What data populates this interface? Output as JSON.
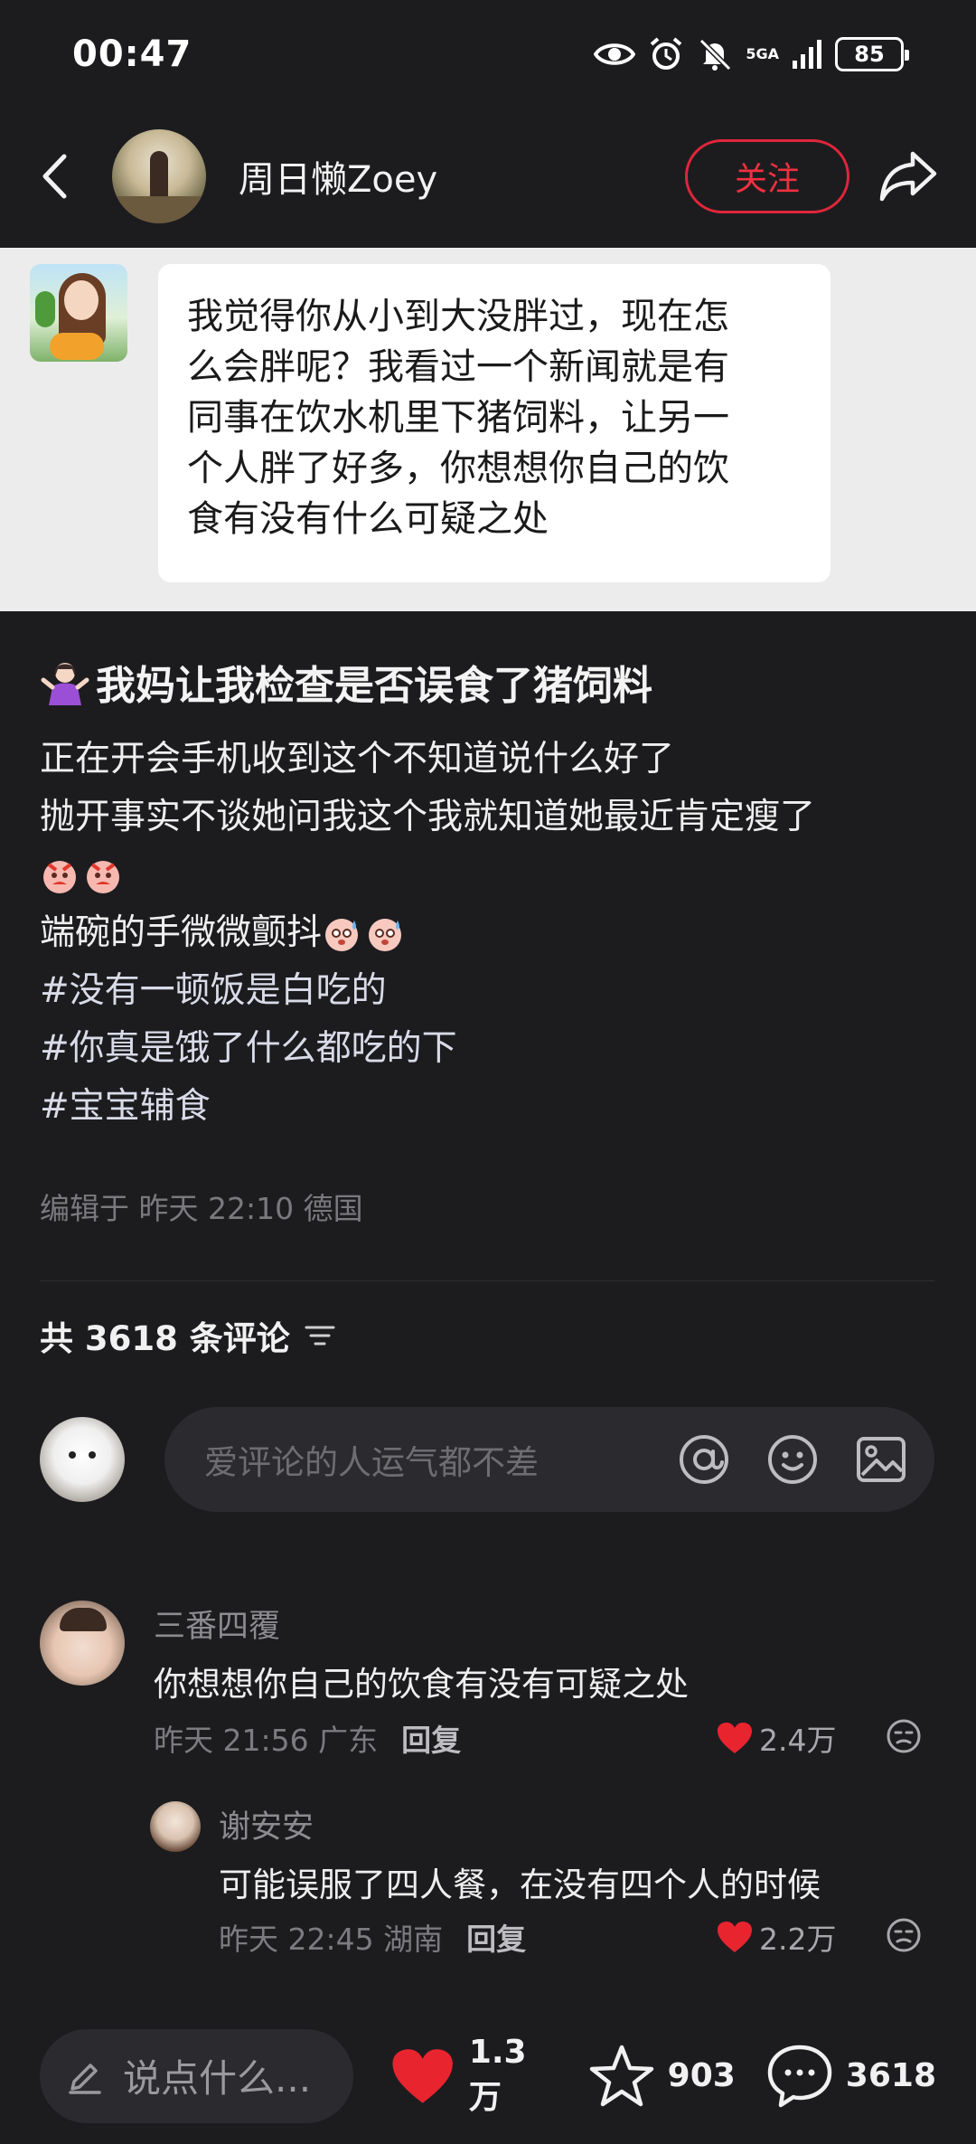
{
  "status_bar": {
    "time": "00:47",
    "network": "5GA",
    "battery": "85"
  },
  "author": {
    "name": "周日懒Zoey",
    "follow_label": "关注"
  },
  "screenshot_chat": {
    "message_lines": [
      "我觉得你从小到大没胖过，现在怎",
      "么会胖呢？我看过一个新闻就是有",
      "同事在饮水机里下猪饲料，让另一",
      "个人胖了好多，你想想你自己的饮",
      "食有没有什么可疑之处"
    ]
  },
  "post": {
    "title": "我妈让我检查是否误食了猪饲料",
    "body_lines": [
      "正在开会手机收到这个不知道说什么好了",
      "抛开事实不谈她问我这个我就知道她最近肯定瘦了",
      "端碗的手微微颤抖"
    ],
    "hashtags": [
      "#没有一顿饭是白吃的",
      "#你真是饿了什么都吃的下",
      "#宝宝辅食"
    ],
    "meta": "编辑于 昨天 22:10 德国"
  },
  "comments_section": {
    "header": "共 3618 条评论",
    "input_placeholder": "爱评论的人运气都不差"
  },
  "comments": [
    {
      "name": "三番四覆",
      "text": "你想想你自己的饮食有没有可疑之处",
      "meta": "昨天 21:56 广东",
      "reply_label": "回复",
      "likes": "2.4万"
    },
    {
      "name": "谢安安",
      "text": "可能误服了四人餐，在没有四个人的时候",
      "meta": "昨天 22:45 湖南",
      "reply_label": "回复",
      "likes": "2.2万"
    }
  ],
  "bottom_bar": {
    "say_placeholder": "说点什么...",
    "likes": "1.3万",
    "favorites": "903",
    "comments": "3618"
  },
  "colors": {
    "background": "#1c1c1f",
    "accent_red": "#f0303f",
    "like_red": "#e8242f"
  }
}
